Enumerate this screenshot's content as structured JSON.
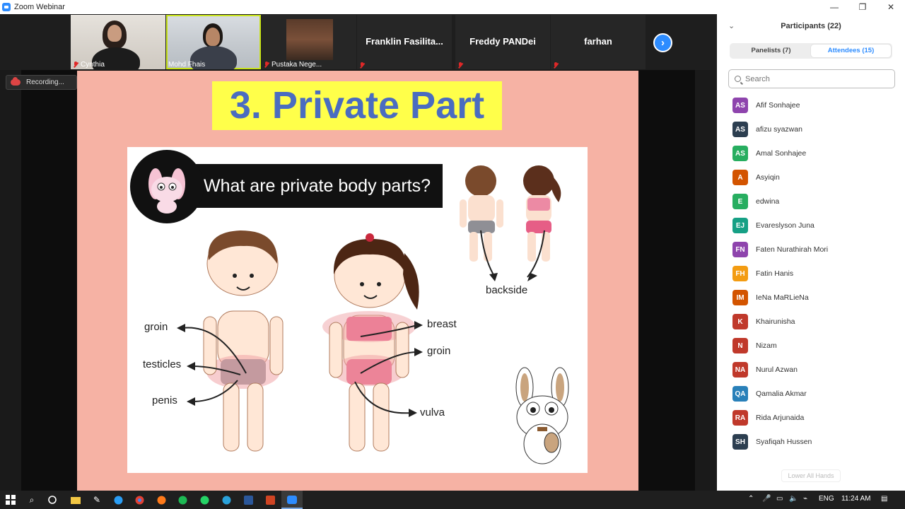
{
  "window": {
    "title": "Zoom Webinar",
    "controls": [
      "—",
      "❐",
      "✕"
    ]
  },
  "video_strip": {
    "tiles": [
      {
        "name": "Cynthia",
        "type": "video"
      },
      {
        "name": "Mohd Fhais",
        "type": "video",
        "active": true
      },
      {
        "name": "Pustaka Nege...",
        "type": "video"
      },
      {
        "name": "Franklin  Fasilita...",
        "type": "name"
      },
      {
        "name": "Freddy PANDei",
        "type": "name"
      },
      {
        "name": "farhan",
        "type": "name"
      }
    ],
    "next_icon": "chevron-right-icon"
  },
  "recording": {
    "label": "Recording..."
  },
  "slide": {
    "title": "3. Private Part",
    "question": "What are private body parts?",
    "labels": {
      "groin_left": "groin",
      "testicles": "testicles",
      "penis": "penis",
      "breast": "breast",
      "groin_right": "groin",
      "vulva": "vulva",
      "backside": "backside"
    },
    "colors": {
      "background": "#f6b2a4",
      "title_bg": "#ffff4a",
      "title_text": "#4a6cc0"
    }
  },
  "participants": {
    "title": "Participants (22)",
    "tabs": [
      {
        "label": "Panelists (7)",
        "active": false
      },
      {
        "label": "Attendees (15)",
        "active": true
      }
    ],
    "search_placeholder": "Search",
    "list": [
      {
        "initials": "AS",
        "name": "Afif Sonhajee",
        "color": "#8e44ad"
      },
      {
        "initials": "AS",
        "name": "afizu syazwan",
        "color": "#2c3e50"
      },
      {
        "initials": "AS",
        "name": "Amal Sonhajee",
        "color": "#27ae60"
      },
      {
        "initials": "A",
        "name": "Asyiqin",
        "color": "#d35400"
      },
      {
        "initials": "E",
        "name": "edwina",
        "color": "#27ae60"
      },
      {
        "initials": "EJ",
        "name": "Evareslyson Juna",
        "color": "#16a085"
      },
      {
        "initials": "FN",
        "name": "Faten Nurathirah Mori",
        "color": "#8e44ad"
      },
      {
        "initials": "FH",
        "name": "Fatin Hanis",
        "color": "#f39c12"
      },
      {
        "initials": "IM",
        "name": "IeNa MaRLieNa",
        "color": "#d35400"
      },
      {
        "initials": "K",
        "name": "Khairunisha",
        "color": "#c0392b"
      },
      {
        "initials": "N",
        "name": "Nizam",
        "color": "#c0392b"
      },
      {
        "initials": "NA",
        "name": "Nurul Azwan",
        "color": "#c0392b"
      },
      {
        "initials": "QA",
        "name": "Qamalia Akmar",
        "color": "#2980b9"
      },
      {
        "initials": "RA",
        "name": "Rida Arjunaida",
        "color": "#c0392b"
      },
      {
        "initials": "SH",
        "name": "Syafiqah Hussen",
        "color": "#2c3e50"
      }
    ],
    "lower_all_hands": "Lower All Hands"
  },
  "taskbar": {
    "apps": [
      "windows-start-icon",
      "search-icon",
      "cortana-icon",
      "file-explorer-icon",
      "pen-app-icon",
      "edge-icon",
      "chrome-icon",
      "firefox-icon",
      "spotify-icon",
      "whatsapp-icon",
      "telegram-icon",
      "word-icon",
      "powerpoint-icon",
      "zoom-icon"
    ],
    "tray": {
      "lang": "ENG",
      "time": "11:24 AM"
    }
  }
}
